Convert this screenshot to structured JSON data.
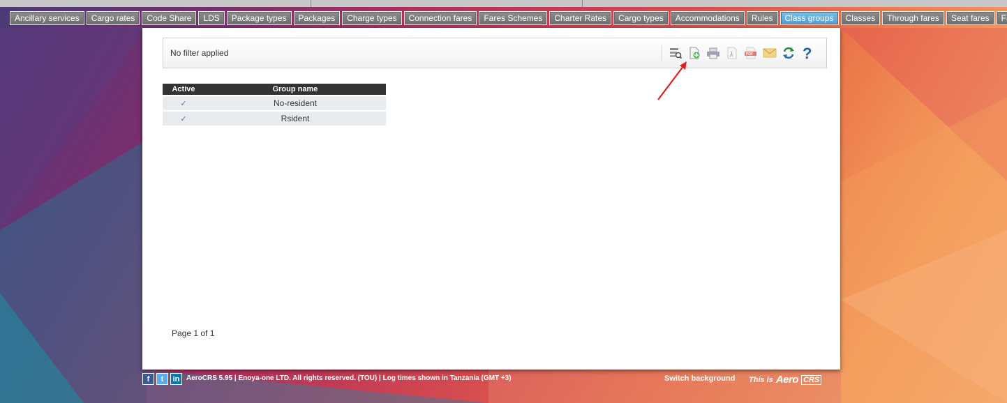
{
  "nav": {
    "items": [
      {
        "label": "Ancillary services",
        "active": false
      },
      {
        "label": "Cargo rates",
        "active": false
      },
      {
        "label": "Code Share",
        "active": false
      },
      {
        "label": "LDS",
        "active": false
      },
      {
        "label": "Package types",
        "active": false
      },
      {
        "label": "Packages",
        "active": false
      },
      {
        "label": "Charge types",
        "active": false
      },
      {
        "label": "Connection fares",
        "active": false
      },
      {
        "label": "Fares Schemes",
        "active": false
      },
      {
        "label": "Charter Rates",
        "active": false
      },
      {
        "label": "Cargo types",
        "active": false
      },
      {
        "label": "Accommodations",
        "active": false
      },
      {
        "label": "Rules",
        "active": false
      },
      {
        "label": "Class groups",
        "active": true
      },
      {
        "label": "Classes",
        "active": false
      },
      {
        "label": "Through fares",
        "active": false
      },
      {
        "label": "Seat fares",
        "active": false
      },
      {
        "label": "Fares",
        "active": false
      }
    ]
  },
  "filter": {
    "text": "No filter applied"
  },
  "toolbar": {
    "icons": [
      "filter-search-icon",
      "add-record-icon",
      "print-icon",
      "font-export-icon",
      "pdf-export-icon",
      "email-icon",
      "refresh-icon",
      "help-icon"
    ]
  },
  "table": {
    "headers": [
      "Active",
      "Group name"
    ],
    "rows": [
      {
        "active": "✓",
        "name": "No-resident"
      },
      {
        "active": "✓",
        "name": "Rsident"
      }
    ]
  },
  "pager": {
    "text": "Page 1 of 1"
  },
  "footer": {
    "social": [
      "f",
      "t",
      "in"
    ],
    "legal": "AeroCRS 5.95  | Enoya-one LTD. All rights reserved. (TOU)  | Log times shown in Tanzania (GMT +3)",
    "switch": "Switch background",
    "brand_prefix": "This is",
    "brand_logo": "Aero",
    "brand_crs": "CRS"
  },
  "colors": {
    "accent": "#4d9fd3",
    "arrow": "#e02020",
    "header_bg": "#333333"
  }
}
